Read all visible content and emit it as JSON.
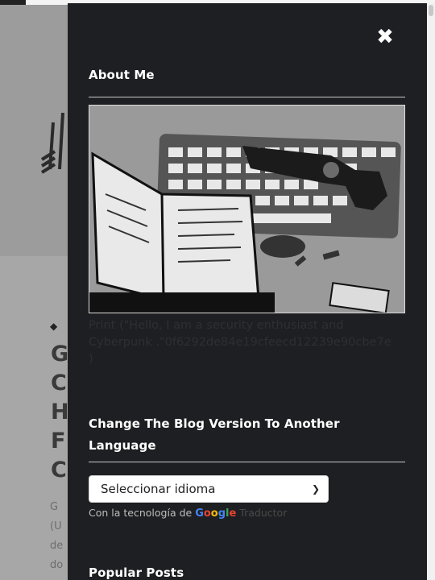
{
  "background": {
    "tag_icon": "tag-icon",
    "post_title_fragment": "G\nC\nH\nF\nC",
    "excerpt_fragment": "G\n(U\nde\ndo"
  },
  "panel": {
    "close_icon": "close-icon",
    "about": {
      "title": "About Me",
      "image_alt": "Sketch of a keyboard, notebook and revolver",
      "bio": "Print (\"Hello, I am a security enthusiast and Cyberpunk .\"0f6292de84e19cfeecd12239e90cbe7e )"
    },
    "language": {
      "title": "Change The Blog Version To Another Language",
      "select_value": "Seleccionar idioma",
      "powered_prefix": "Con la tecnología de",
      "google_letters": [
        "G",
        "o",
        "o",
        "g",
        "l",
        "e"
      ],
      "powered_suffix": "Traductor"
    },
    "popular_posts_title": "Popular Posts"
  },
  "colors": {
    "panel_bg": "#1e1f22",
    "overlay_bg": "#a7a7a7",
    "heading": "#ffffff"
  }
}
